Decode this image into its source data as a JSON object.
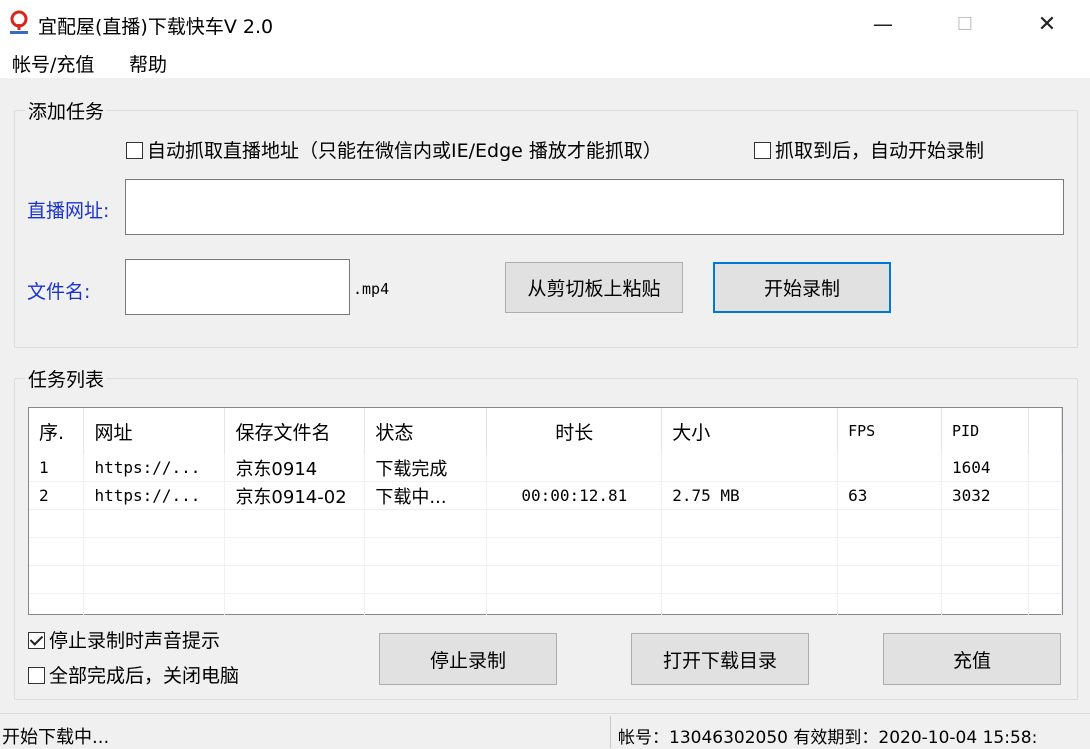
{
  "window": {
    "title": "宜配屋(直播)下载快车V 2.0",
    "controls": {
      "minimize": "—",
      "maximize": "☐",
      "close": "✕"
    }
  },
  "menu": [
    "帐号/充值",
    "帮助"
  ],
  "add_task": {
    "legend": "添加任务",
    "auto_capture_label": "自动抓取直播地址（只能在微信内或IE/Edge 播放才能抓取）",
    "auto_capture_checked": false,
    "auto_start_label": "抓取到后，自动开始录制",
    "auto_start_checked": false,
    "url_label": "直播网址:",
    "url_value": "",
    "filename_label": "文件名:",
    "filename_value": "",
    "ext_label": ".mp4",
    "paste_button": "从剪切板上粘贴",
    "start_button": "开始录制"
  },
  "task_list": {
    "legend": "任务列表",
    "columns": [
      "序.",
      "网址",
      "保存文件名",
      "状态",
      "时长",
      "大小",
      "FPS",
      "PID"
    ],
    "rows": [
      [
        "1",
        "https://...",
        "京东0914",
        "下载完成",
        "",
        "",
        "",
        "1604"
      ],
      [
        "2",
        "https://...",
        "京东0914-02",
        "下载中...",
        "00:00:12.81",
        "2.75 MB",
        "63",
        "3032"
      ]
    ]
  },
  "options": {
    "sound_label": "停止录制时声音提示",
    "sound_checked": true,
    "shutdown_label": "全部完成后，关闭电脑",
    "shutdown_checked": false
  },
  "buttons": {
    "stop": "停止录制",
    "open_dir": "打开下载目录",
    "recharge": "充值"
  },
  "status": {
    "left": "开始下载中...",
    "right": "帐号：13046302050 有效期到：2020-10-04 15:58:"
  },
  "colors": {
    "label_blue": "#1a33cc",
    "default_button_border": "#0078d7",
    "icon_red": "#d9261c"
  }
}
